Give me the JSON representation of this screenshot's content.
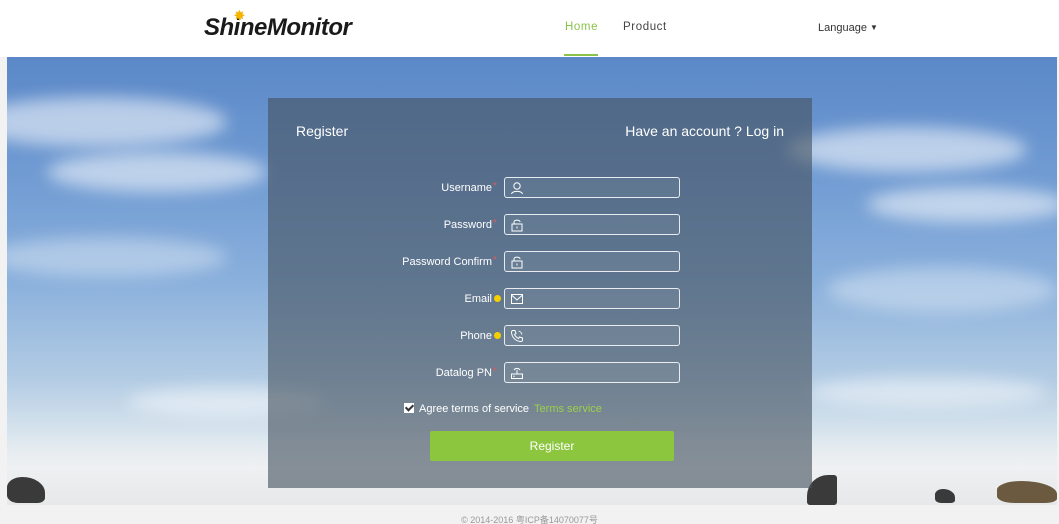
{
  "header": {
    "logo_part1": "Shine",
    "logo_part2": "Monitor",
    "nav": {
      "home": "Home",
      "product": "Product"
    },
    "language_label": "Language"
  },
  "register": {
    "title": "Register",
    "login_link": "Have an account ? Log in",
    "fields": [
      {
        "label": "Username",
        "marker": "required",
        "icon": "user-icon",
        "value": ""
      },
      {
        "label": "Password",
        "marker": "required",
        "icon": "lock-icon",
        "value": ""
      },
      {
        "label": "Password Confirm",
        "marker": "required",
        "icon": "lock-icon",
        "value": ""
      },
      {
        "label": "Email",
        "marker": "optional-dot",
        "icon": "mail-icon",
        "value": ""
      },
      {
        "label": "Phone",
        "marker": "optional-dot",
        "icon": "phone-icon",
        "value": ""
      },
      {
        "label": "Datalog PN",
        "marker": "required",
        "icon": "router-icon",
        "value": ""
      }
    ],
    "required_mark": "*",
    "agree_label": "Agree terms of service",
    "terms_link": "Terms service",
    "agree_checked": true,
    "submit_label": "Register"
  },
  "footer": {
    "text": "© 2014-2016 粤ICP备14070077号"
  },
  "colors": {
    "accent": "#8cc63f",
    "required": "#e05a5a",
    "optional_dot": "#f5d000",
    "panel": "#46525e"
  }
}
